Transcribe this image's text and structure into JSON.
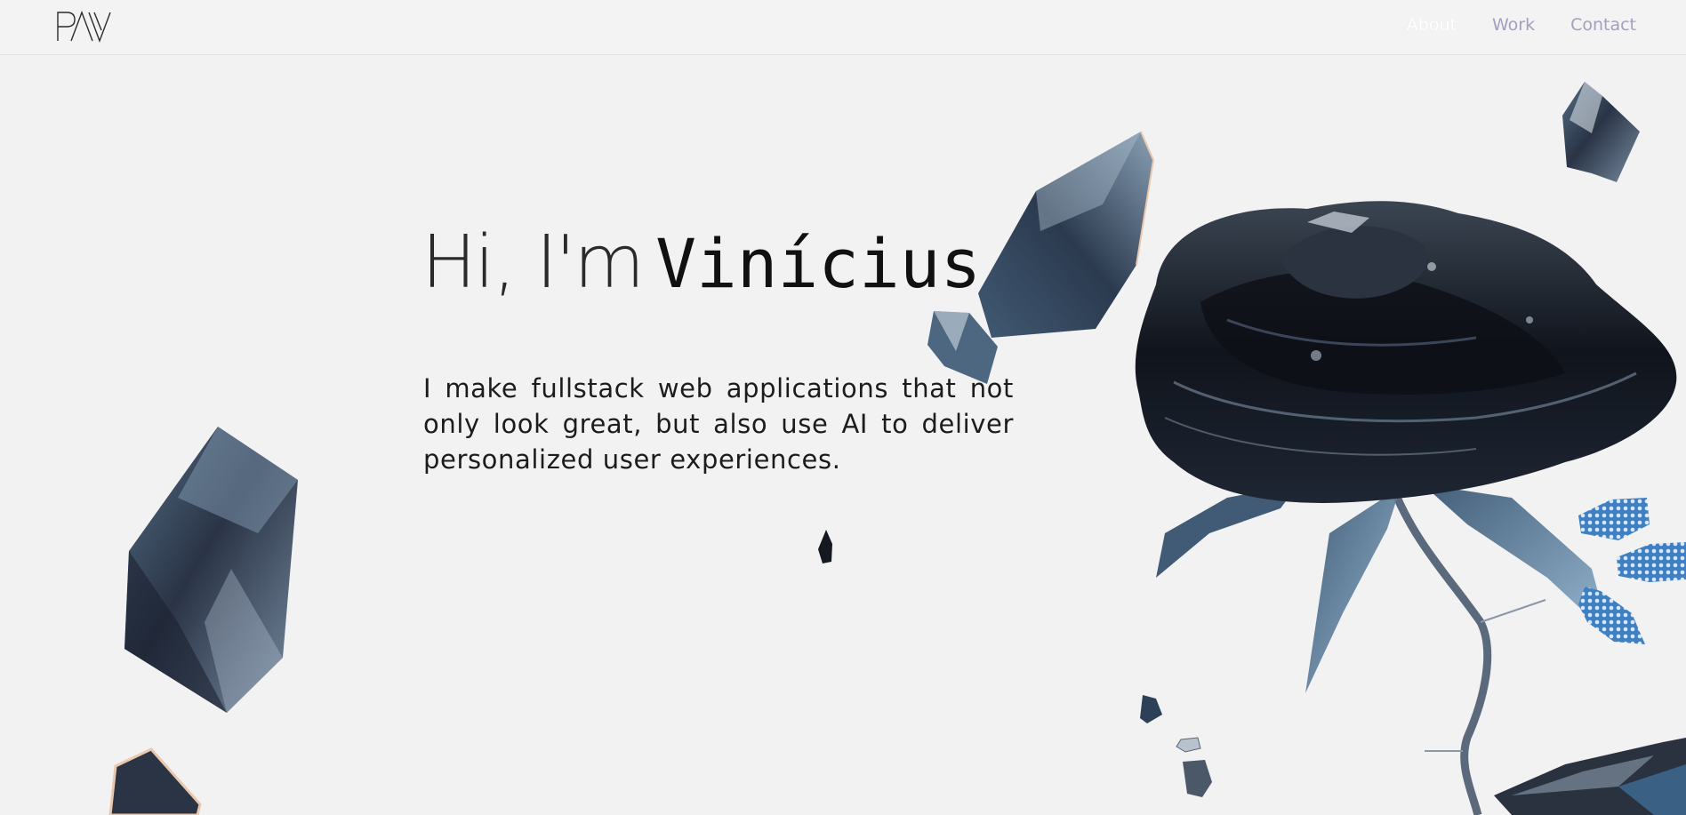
{
  "brand": {
    "logo_text": "PAV"
  },
  "nav": {
    "items": [
      {
        "label": "About",
        "active": true
      },
      {
        "label": "Work",
        "active": false
      },
      {
        "label": "Contact",
        "active": false
      }
    ]
  },
  "hero": {
    "greeting": "Hi, I'm",
    "name": "Vinícius",
    "description": "I make fullstack web applications that not only look great, but also use AI to deliver personalized user experiences."
  },
  "colors": {
    "background": "#f3f2f2",
    "nav_link": "#a3a0bd",
    "nav_active": "#ffffff",
    "crystal_dark": "#1b2230",
    "crystal_blue": "#3f6d93"
  },
  "icons": [
    "logo-mark",
    "crystal-shard-icon",
    "crystal-rose-icon"
  ]
}
